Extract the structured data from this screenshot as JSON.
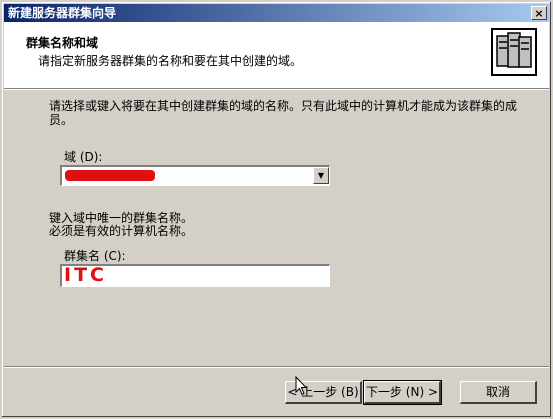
{
  "window": {
    "title": "新建服务器群集向导",
    "close_glyph": "×"
  },
  "header": {
    "title": "群集名称和域",
    "subtitle": "请指定新服务器群集的名称和要在其中创建的域。",
    "icon": "server-cluster-icon"
  },
  "body": {
    "instruction": "请选择或键入将要在其中创建群集的域的名称。只有此域中的计算机才能成为该群集的成员。",
    "domain_label": "域 (D):",
    "domain_value_redacted": true,
    "cluster_hint_1": "键入域中唯一的群集名称。",
    "cluster_hint_2": "必须是有效的计算机名称。",
    "cluster_name_label": "群集名 (C):",
    "cluster_name_value": "ITC"
  },
  "buttons": {
    "back": "< 上一步 (B)",
    "next": "下一步 (N) >",
    "cancel": "取消"
  },
  "colors": {
    "titlebar": "#0a246a",
    "dialog_bg": "#d4d0c8",
    "redaction": "#e01010"
  }
}
